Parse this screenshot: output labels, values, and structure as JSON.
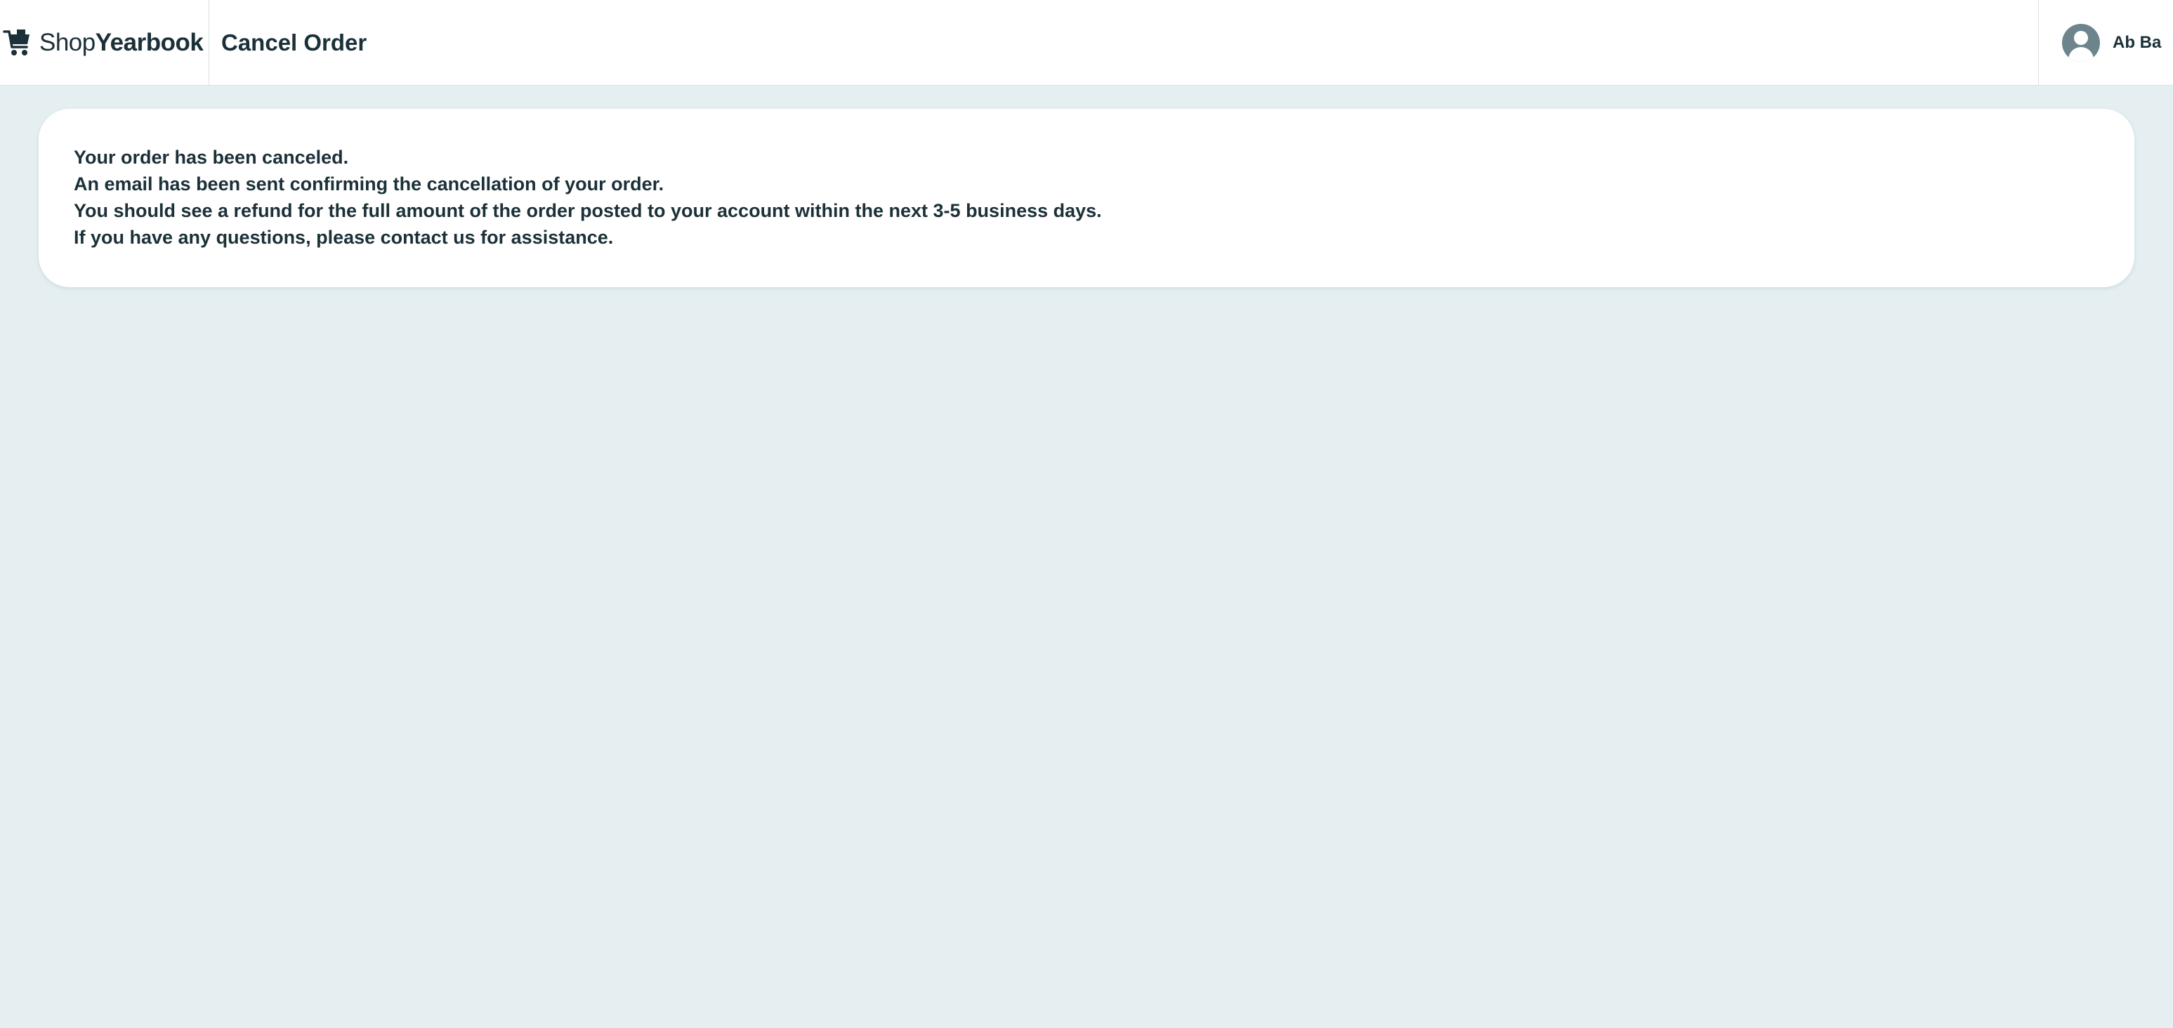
{
  "header": {
    "brand": {
      "prefix": "Shop",
      "suffix": "Yearbook",
      "icon": "shopping-cart-icon"
    },
    "title": "Cancel Order",
    "user": {
      "name": "Ab Ba",
      "icon": "user-avatar-icon"
    }
  },
  "message": {
    "lines": [
      "Your order has been canceled.",
      "An email has been sent confirming the cancellation of your order.",
      "You should see a refund for the full amount of the order posted to your account within the next 3-5 business days.",
      "If you have any questions, please contact us for assistance."
    ]
  },
  "colors": {
    "background": "#e5eff2",
    "text": "#1b3038",
    "avatar": "#6e848c"
  }
}
